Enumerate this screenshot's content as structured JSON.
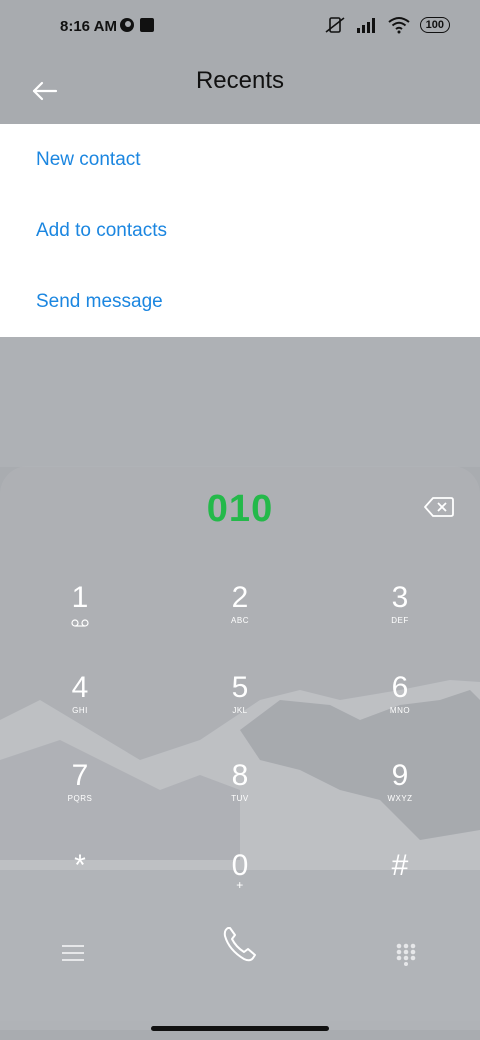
{
  "status_bar": {
    "time": "8:16 AM",
    "battery": "100"
  },
  "header": {
    "title": "Recents"
  },
  "menu": {
    "items": [
      {
        "label": "New contact"
      },
      {
        "label": "Add to contacts"
      },
      {
        "label": "Send message"
      }
    ]
  },
  "dialer": {
    "number": "010",
    "keys": [
      {
        "digit": "1",
        "letters": ""
      },
      {
        "digit": "2",
        "letters": "ABC"
      },
      {
        "digit": "3",
        "letters": "DEF"
      },
      {
        "digit": "4",
        "letters": "GHI"
      },
      {
        "digit": "5",
        "letters": "JKL"
      },
      {
        "digit": "6",
        "letters": "MNO"
      },
      {
        "digit": "7",
        "letters": "PQRS"
      },
      {
        "digit": "8",
        "letters": "TUV"
      },
      {
        "digit": "9",
        "letters": "WXYZ"
      },
      {
        "digit": "*",
        "letters": ""
      },
      {
        "digit": "0",
        "letters": "+"
      },
      {
        "digit": "#",
        "letters": ""
      }
    ]
  },
  "colors": {
    "accent_blue": "#1b86e0",
    "number_green": "#24b94a"
  },
  "icons": {
    "back": "arrow-left-icon",
    "backspace": "backspace-icon",
    "voicemail": "voicemail-icon",
    "call": "phone-icon",
    "menu": "hamburger-icon",
    "dialpad": "dialpad-icon"
  }
}
